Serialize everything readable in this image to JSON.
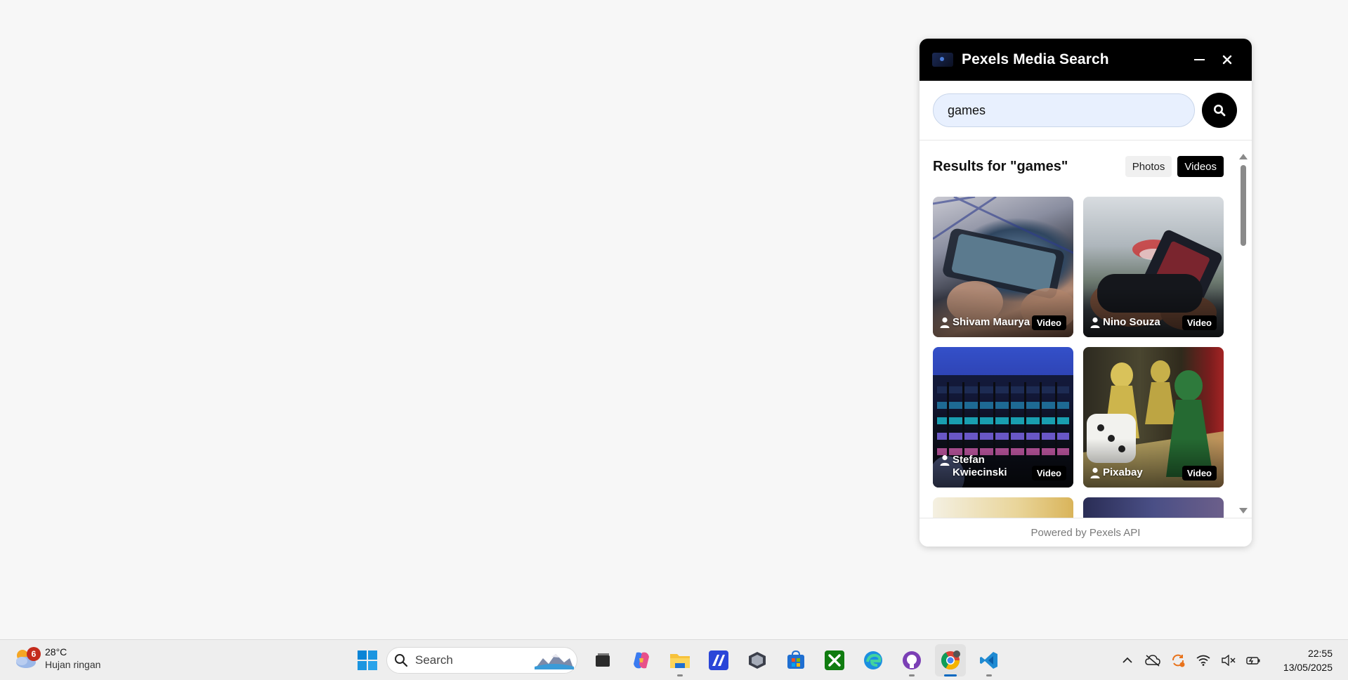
{
  "popup": {
    "title": "Pexels Media Search",
    "search": {
      "value": "games",
      "placeholder": ""
    },
    "results_title": "Results for \"games\"",
    "toggles": {
      "photos": "Photos",
      "videos": "Videos",
      "active": "videos"
    },
    "cards": [
      {
        "author": "Shivam Maurya",
        "badge": "Video"
      },
      {
        "author": "Nino Souza",
        "badge": "Video"
      },
      {
        "author": "Stefan Kwiecinski",
        "badge": "Video"
      },
      {
        "author": "Pixabay",
        "badge": "Video"
      }
    ],
    "footer": "Powered by Pexels API"
  },
  "taskbar": {
    "weather": {
      "badge": "6",
      "temp": "28°C",
      "desc": "Hujan ringan"
    },
    "search_label": "Search",
    "apps": [
      "task-view",
      "copilot",
      "file-explorer",
      "editor-app",
      "3d-app",
      "microsoft-store",
      "xbox",
      "edge",
      "github-desktop",
      "chrome",
      "vscode"
    ],
    "clock": {
      "time": "22:55",
      "date": "13/05/2025"
    }
  },
  "colors": {
    "accent": "#000000",
    "search_bg": "#e8f0fe",
    "taskbar_active": "#0067c0"
  }
}
